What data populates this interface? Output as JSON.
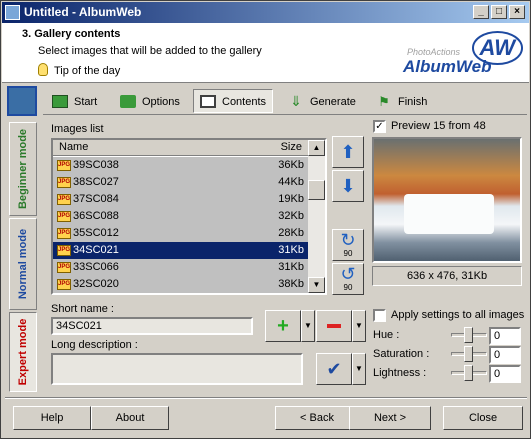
{
  "window": {
    "title": "Untitled - AlbumWeb"
  },
  "header": {
    "step_title": "3. Gallery contents",
    "subtitle": "Select images that will be added to the gallery",
    "tip": "Tip of the day",
    "logo_sub": "PhotoActions",
    "logo_main": "AlbumWeb",
    "logo_mark": "AW"
  },
  "sidebar": {
    "modes": [
      {
        "label": "Beginner mode",
        "color": "#2a7a2a"
      },
      {
        "label": "Normal mode",
        "color": "#1e4aa0"
      },
      {
        "label": "Expert mode",
        "color": "#c00000",
        "active": true
      }
    ]
  },
  "toolbar": {
    "tabs": [
      {
        "label": "Start",
        "icon": "start-icon"
      },
      {
        "label": "Options",
        "icon": "folder-icon"
      },
      {
        "label": "Contents",
        "icon": "contents-icon",
        "active": true
      },
      {
        "label": "Generate",
        "icon": "down-arrow-icon"
      },
      {
        "label": "Finish",
        "icon": "flag-icon"
      }
    ]
  },
  "images": {
    "label": "Images list",
    "columns": {
      "name": "Name",
      "size": "Size"
    },
    "rows": [
      {
        "name": "39SC038",
        "size": "36Kb"
      },
      {
        "name": "38SC027",
        "size": "44Kb"
      },
      {
        "name": "37SC084",
        "size": "19Kb"
      },
      {
        "name": "36SC088",
        "size": "32Kb"
      },
      {
        "name": "35SC012",
        "size": "28Kb"
      },
      {
        "name": "34SC021",
        "size": "31Kb",
        "selected": true
      },
      {
        "name": "33SC066",
        "size": "31Kb"
      },
      {
        "name": "32SC020",
        "size": "38Kb"
      }
    ],
    "file_badge": "JPG"
  },
  "preview": {
    "checkbox_label": "Preview 15 from 48",
    "checked": true,
    "info": "636 x 476, 31Kb"
  },
  "rotate": {
    "label": "90"
  },
  "details": {
    "short_name_label": "Short name :",
    "short_name_value": "34SC021",
    "long_desc_label": "Long description :",
    "long_desc_value": ""
  },
  "adjust": {
    "apply_label": "Apply settings to all images",
    "hue_label": "Hue :",
    "hue_value": "0",
    "saturation_label": "Saturation :",
    "saturation_value": "0",
    "lightness_label": "Lightness :",
    "lightness_value": "0"
  },
  "footer": {
    "help": "Help",
    "about": "About",
    "back": "< Back",
    "next": "Next >",
    "close": "Close"
  },
  "colors": {
    "accent": "#0a246a",
    "add": "#22aa22",
    "remove": "#dd2222",
    "arrow": "#2060c0"
  }
}
